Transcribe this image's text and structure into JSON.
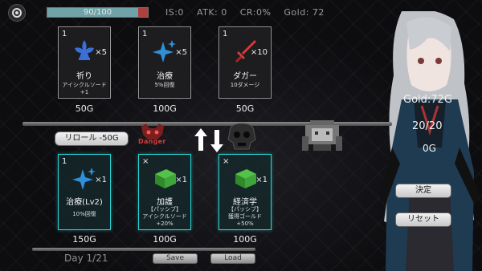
{
  "header": {
    "hp_text": "90/100",
    "hp_fraction": 0.9,
    "stats": {
      "is": "IS:0",
      "atk": "ATK: 0",
      "cr": "CR:0%",
      "gold": "Gold: 72"
    }
  },
  "shop_top": [
    {
      "num": "1",
      "icon": "fleur-de-lis-icon",
      "mult": "×5",
      "title": "祈り",
      "desc1": "アイシクルソード",
      "desc2": "+1",
      "price": "50G"
    },
    {
      "num": "1",
      "icon": "sparkle-icon",
      "mult": "×5",
      "title": "治療",
      "desc1": "5%回復",
      "desc2": "",
      "price": "100G"
    },
    {
      "num": "1",
      "icon": "sword-icon",
      "mult": "×10",
      "title": "ダガー",
      "desc1": "10ダメージ",
      "desc2": "",
      "price": "50G"
    }
  ],
  "shop_bottom": [
    {
      "num": "1",
      "icon": "sparkle-icon",
      "mult": "×1",
      "title": "治療(Lv2)",
      "desc1": "10%回復",
      "desc2": "",
      "desc3": "",
      "price": "150G"
    },
    {
      "num": "×",
      "icon": "book-icon",
      "mult": "×1",
      "title": "加護",
      "desc1": "【パッシブ】",
      "desc2": "アイシクルソード",
      "desc3": "+20%",
      "price": "100G"
    },
    {
      "num": "×",
      "icon": "book-icon",
      "mult": "×1",
      "title": "経済学",
      "desc1": "【パッシブ】",
      "desc2": "獲得ゴールド",
      "desc3": "+50%",
      "price": "100G"
    }
  ],
  "reroll_label": "リロール -50G",
  "danger_label": "Danger",
  "right_panel": {
    "gold": "Gold:72G",
    "hp": "20/20",
    "og": "0G"
  },
  "buttons": {
    "decide": "決定",
    "reset": "リセット",
    "save": "Save",
    "load": "Load"
  },
  "footer": {
    "day": "Day 1/21"
  },
  "colors": {
    "accent_cyan": "#2bd3d3",
    "hp_fill": "#6fa3a7",
    "hp_bg": "#b04040",
    "danger": "#d43a3a"
  }
}
